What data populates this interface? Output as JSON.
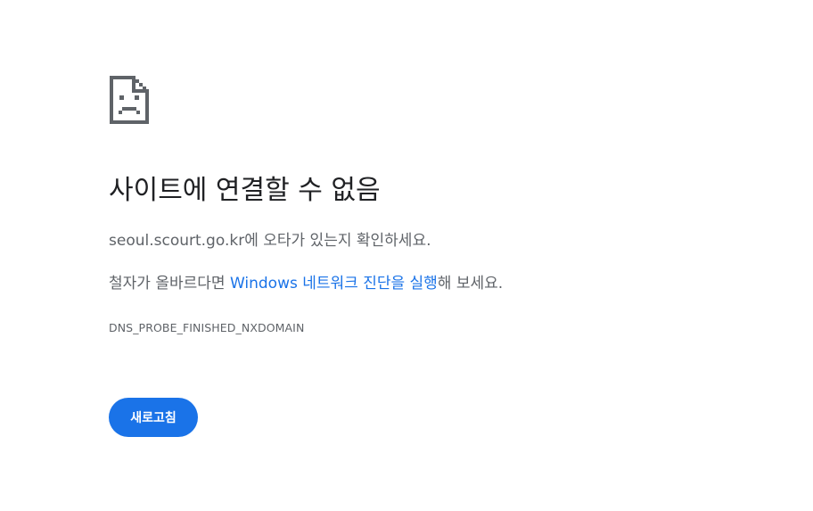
{
  "icon": {
    "name": "sad-page-icon",
    "color": "#5f6368"
  },
  "title": "사이트에 연결할 수 없음",
  "suggestion1": {
    "domain": "seoul.scourt.go.kr",
    "text": "에 오타가 있는지 확인하세요."
  },
  "suggestion2": {
    "prefix": "철자가 올바르다면 ",
    "link": "Windows 네트워크 진단을 실행",
    "suffix": "해 보세요."
  },
  "error_code": "DNS_PROBE_FINISHED_NXDOMAIN",
  "reload_label": "새로고침",
  "colors": {
    "accent": "#1a73e8",
    "title_text": "#202124",
    "body_text": "#5f6368"
  }
}
